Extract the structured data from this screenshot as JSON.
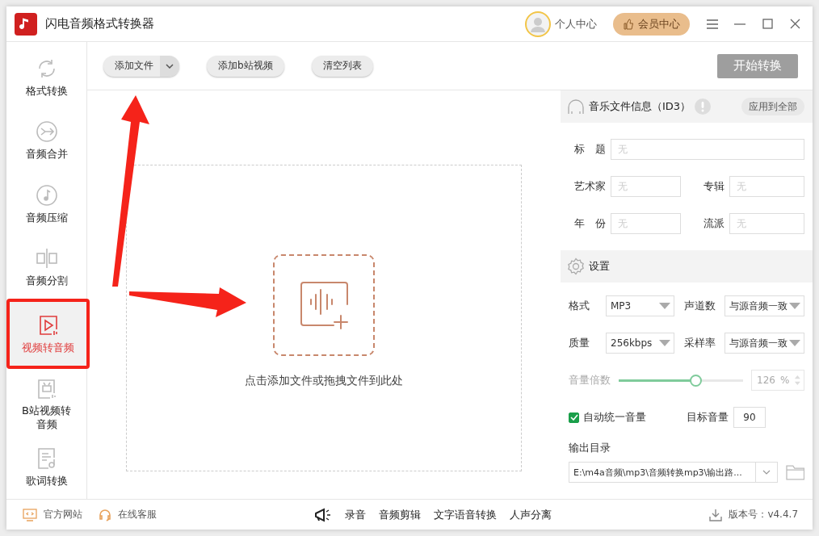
{
  "window": {
    "title": "闪电音频格式转换器"
  },
  "header": {
    "user_label": "个人中心",
    "vip_button": "会员中心"
  },
  "sidebar": {
    "items": [
      {
        "label": "格式转换",
        "selected": false
      },
      {
        "label": "音频合并",
        "selected": false
      },
      {
        "label": "音频压缩",
        "selected": false
      },
      {
        "label": "音频分割",
        "selected": false
      },
      {
        "label": "视频转音频",
        "selected": true
      },
      {
        "label": "B站视频转音频",
        "selected": false
      },
      {
        "label": "歌词转换",
        "selected": false
      }
    ]
  },
  "toolbar": {
    "buttons": [
      {
        "label": "添加文件"
      },
      {
        "label": "添加b站视频"
      },
      {
        "label": "清空列表"
      }
    ],
    "start_button": "开始转换"
  },
  "dropzone": {
    "hint": "点击添加文件或拖拽文件到此处"
  },
  "id3": {
    "title": "音乐文件信息（ID3）",
    "apply_button": "应用到全部",
    "fields": [
      {
        "label": "标　题",
        "placeholder": "无"
      },
      {
        "label": "艺术家",
        "placeholder": "无"
      },
      {
        "label": "专辑",
        "placeholder": "无"
      },
      {
        "label": "年　份",
        "placeholder": "无"
      },
      {
        "label": "流派",
        "placeholder": "无"
      }
    ]
  },
  "settings": {
    "title": "设置",
    "selects": [
      {
        "label": "格式",
        "value": "MP3"
      },
      {
        "label": "声道数",
        "value": "与源音频一致"
      },
      {
        "label": "质量",
        "value": "256kbps"
      },
      {
        "label": "采样率",
        "value": "与源音频一致"
      }
    ],
    "volume": {
      "label": "音量倍数",
      "level": 0.62,
      "value": "126",
      "unit": "%"
    },
    "auto_volume": {
      "label": "自动统一音量",
      "checked": true
    },
    "target_volume": {
      "label": "目标音量",
      "value": "90"
    },
    "output": {
      "label": "输出目录",
      "value": "E:\\m4a音频\\mp3\\音频转换mp3\\输出路..."
    }
  },
  "footer": {
    "links": [
      {
        "label": "官方网站"
      },
      {
        "label": "在线客服"
      }
    ],
    "tools": [
      {
        "label": "录音"
      },
      {
        "label": "音频剪辑"
      },
      {
        "label": "文字语音转换"
      },
      {
        "label": "人声分离"
      }
    ],
    "version": "版本号：v4.4.7"
  }
}
